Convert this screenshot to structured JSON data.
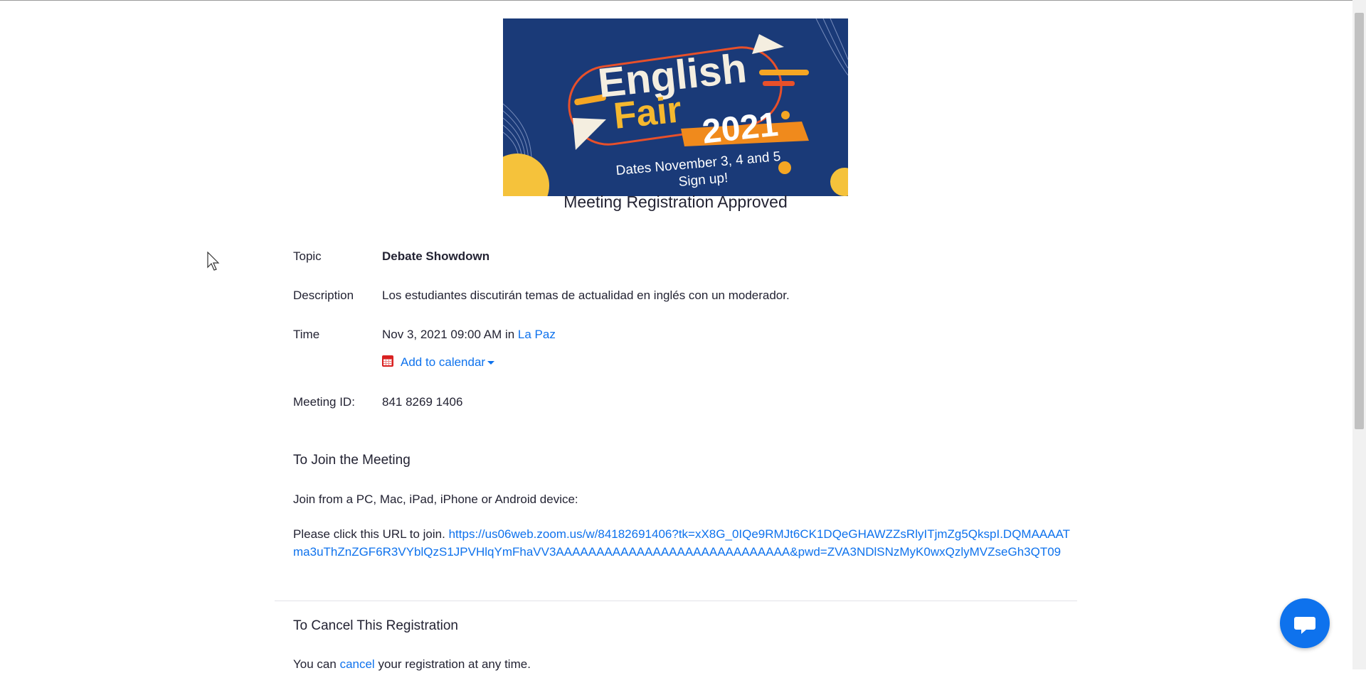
{
  "banner": {
    "line1": "English",
    "line2": "Fair",
    "year": "2021",
    "dates": "Dates November 3, 4 and 5",
    "signup": "Sign up!"
  },
  "page_title": "Meeting Registration Approved",
  "details": {
    "topic_label": "Topic",
    "topic_value": "Debate Showdown",
    "description_label": "Description",
    "description_value": "Los estudiantes discutirán temas de actualidad en inglés con un moderador.",
    "time_label": "Time",
    "time_value": "Nov 3, 2021 09:00 AM in",
    "timezone_link": "La Paz",
    "add_to_calendar": "Add to calendar",
    "meeting_id_label": "Meeting ID:",
    "meeting_id_value": "841 8269 1406"
  },
  "join_section": {
    "title": "To Join the Meeting",
    "devices_text": "Join from a PC, Mac, iPad, iPhone or Android device:",
    "click_text": "Please click this URL to join.",
    "join_url": "https://us06web.zoom.us/w/84182691406?tk=xX8G_0IQe9RMJt6CK1DQeGHAWZZsRlyITjmZg5QkspI.DQMAAAATma3uThZnZGF6R3VYblQzS1JPVHlqYmFhaVV3AAAAAAAAAAAAAAAAAAAAAAAAAAAAA&pwd=ZVA3NDlSNzMyK0wxQzlyMVZseGh3QT09"
  },
  "cancel_section": {
    "title": "To Cancel This Registration",
    "text_before": "You can",
    "cancel_link": "cancel",
    "text_after": "your registration at any time."
  },
  "colors": {
    "link": "#0e72ed",
    "calendar_icon": "#d92121",
    "chat_button": "#0e72ed",
    "banner_bg": "#1a3a78"
  },
  "icons": {
    "calendar": "calendar-icon",
    "chat": "chat-bubble-icon",
    "caret": "caret-down-icon",
    "cursor": "mouse-cursor-icon"
  }
}
